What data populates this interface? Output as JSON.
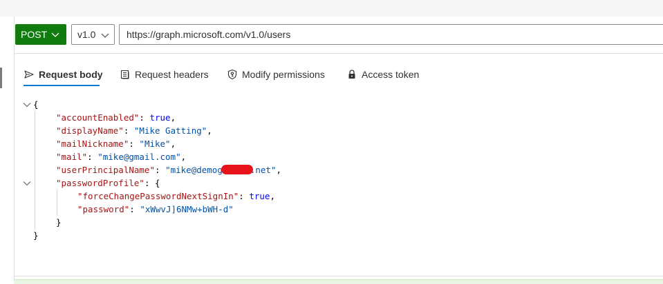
{
  "request": {
    "method": "POST",
    "version": "v1.0",
    "url": "https://graph.microsoft.com/v1.0/users"
  },
  "tabs": [
    {
      "label": "Request body",
      "icon": "send-icon",
      "active": true
    },
    {
      "label": "Request headers",
      "icon": "headers-icon",
      "active": false
    },
    {
      "label": "Modify permissions",
      "icon": "shield-key-icon",
      "active": false
    },
    {
      "label": "Access token",
      "icon": "lock-icon",
      "active": false
    }
  ],
  "body": {
    "open_brace": "{",
    "close_brace": "}",
    "lines": [
      {
        "key": "\"accountEnabled\"",
        "sep": ": ",
        "value": "true",
        "value_type": "bool",
        "end": ","
      },
      {
        "key": "\"displayName\"",
        "sep": ": ",
        "value": "\"Mike Gatting\"",
        "value_type": "string",
        "end": ","
      },
      {
        "key": "\"mailNickname\"",
        "sep": ": ",
        "value": "\"Mike\"",
        "value_type": "string",
        "end": ","
      },
      {
        "key": "\"mail\"",
        "sep": ": ",
        "value": "\"mike@gmail.com\"",
        "value_type": "string",
        "end": ","
      },
      {
        "key": "\"userPrincipalName\"",
        "sep": ": ",
        "value_pre": "\"mike@demog",
        "value_post": ".net\"",
        "value_type": "string",
        "end": ","
      },
      {
        "key": "\"passwordProfile\"",
        "sep": ": ",
        "value": "{",
        "value_type": "punct",
        "end": ""
      }
    ],
    "nested": [
      {
        "key": "\"forceChangePasswordNextSignIn\"",
        "sep": ": ",
        "value": "true",
        "value_type": "bool",
        "end": ","
      },
      {
        "key": "\"password\"",
        "sep": ": ",
        "value": "\"xWwvJ]6NMw+bWH-d\"",
        "value_type": "string",
        "end": ""
      }
    ],
    "nested_close": "}"
  },
  "colors": {
    "method_green": "#107c10",
    "accent_blue": "#0078d4",
    "json_key": "#a31515",
    "json_string": "#0451a5",
    "json_bool": "#0000ff",
    "redaction": "#e8141c"
  }
}
